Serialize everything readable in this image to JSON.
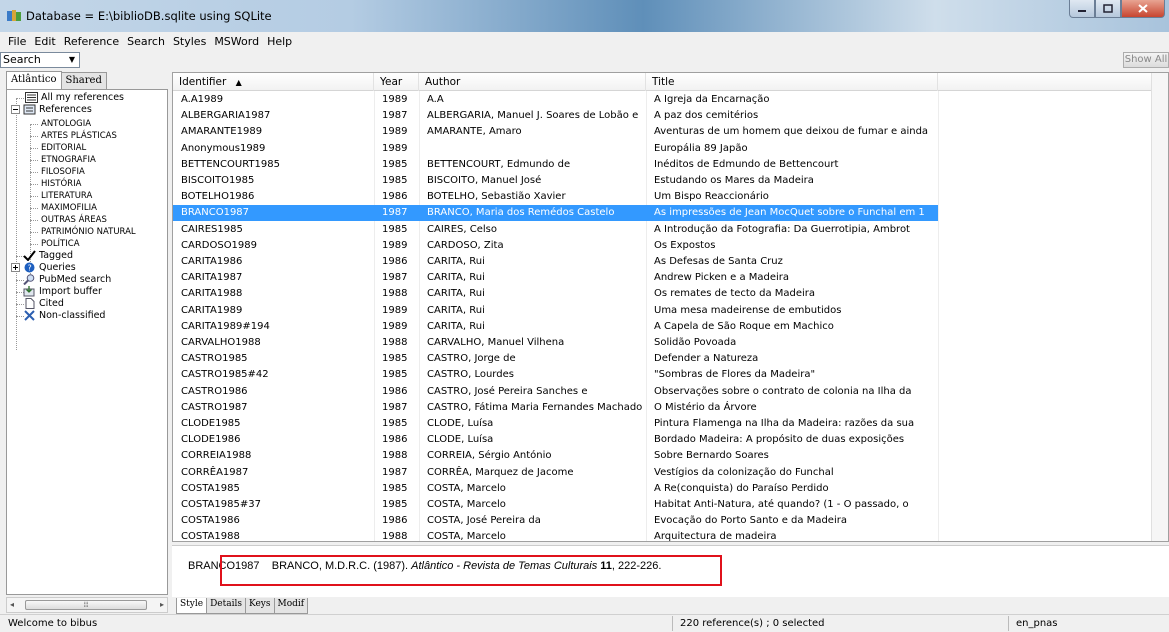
{
  "window": {
    "title": "Database = E:\\biblioDB.sqlite using SQLite",
    "buttons": [
      "min",
      "max",
      "close"
    ]
  },
  "menu": [
    "File",
    "Edit",
    "Reference",
    "Search",
    "Styles",
    "MSWord",
    "Help"
  ],
  "search": {
    "value": "Search",
    "show_all": "Show All"
  },
  "left_tabs": [
    "Atlântico",
    "Shared"
  ],
  "tree": {
    "all_refs": "All my references",
    "references": "References",
    "categories": [
      "ANTOLOGIA",
      "ARTES PLÁSTICAS",
      "EDITORIAL",
      "ETNOGRAFIA",
      "FILOSOFIA",
      "HISTÓRIA",
      "LITERATURA",
      "MAXIMOFILIA",
      "OUTRAS ÁREAS",
      "PATRIMÓNIO NATURAL",
      "POLÍTICA"
    ],
    "tagged": "Tagged",
    "queries": "Queries",
    "pubmed": "PubMed search",
    "import": "Import buffer",
    "cited": "Cited",
    "nonclassified": "Non-classified"
  },
  "table": {
    "headers": [
      "Identifier",
      "Year",
      "Author",
      "Title"
    ],
    "rows": [
      [
        "A.A1989",
        "1989",
        "A.A",
        "A Igreja da Encarnação"
      ],
      [
        "ALBERGARIA1987",
        "1987",
        "ALBERGARIA, Manuel J. Soares de Lobão e",
        "A paz dos cemitérios"
      ],
      [
        "AMARANTE1989",
        "1989",
        "AMARANTE, Amaro",
        "Aventuras de um homem que deixou de fumar e ainda"
      ],
      [
        "Anonymous1989",
        "1989",
        "",
        "Europália 89 Japão"
      ],
      [
        "BETTENCOURT1985",
        "1985",
        "BETTENCOURT, Edmundo de",
        "Inéditos de Edmundo de Bettencourt"
      ],
      [
        "BISCOITO1985",
        "1985",
        "BISCOITO, Manuel José",
        "Estudando os Mares da Madeira"
      ],
      [
        "BOTELHO1986",
        "1986",
        "BOTELHO, Sebastião Xavier",
        "Um Bispo Reaccionário"
      ],
      [
        "BRANCO1987",
        "1987",
        "BRANCO, Maria dos Remédos Castelo",
        "As impressões de Jean MocQuet sobre o Funchal em 1"
      ],
      [
        "CAIRES1985",
        "1985",
        "CAIRES, Celso",
        "A Introdução da Fotografia: Da Guerrotipia, Ambrot"
      ],
      [
        "CARDOSO1989",
        "1989",
        "CARDOSO, Zita",
        "Os Expostos"
      ],
      [
        "CARITA1986",
        "1986",
        "CARITA, Rui",
        "As Defesas de Santa Cruz"
      ],
      [
        "CARITA1987",
        "1987",
        "CARITA, Rui",
        "Andrew Picken e a Madeira"
      ],
      [
        "CARITA1988",
        "1988",
        "CARITA, Rui",
        "Os remates de tecto da Madeira"
      ],
      [
        "CARITA1989",
        "1989",
        "CARITA, Rui",
        "Uma mesa madeirense de embutidos"
      ],
      [
        "CARITA1989#194",
        "1989",
        "CARITA, Rui",
        "A Capela de São Roque em Machico"
      ],
      [
        "CARVALHO1988",
        "1988",
        "CARVALHO, Manuel Vilhena",
        "Solidão Povoada"
      ],
      [
        "CASTRO1985",
        "1985",
        "CASTRO, Jorge de",
        "Defender a Natureza"
      ],
      [
        "CASTRO1985#42",
        "1985",
        "CASTRO, Lourdes",
        "\"Sombras de Flores da Madeira\""
      ],
      [
        "CASTRO1986",
        "1986",
        "CASTRO, José Pereira Sanches e",
        "Observações sobre o contrato de colonia na Ilha da"
      ],
      [
        "CASTRO1987",
        "1987",
        "CASTRO, Fátima Maria Fernandes Machado",
        "O Mistério da Árvore"
      ],
      [
        "CLODE1985",
        "1985",
        "CLODE, Luísa",
        "Pintura Flamenga na Ilha da Madeira: razões da sua"
      ],
      [
        "CLODE1986",
        "1986",
        "CLODE, Luísa",
        "Bordado Madeira: A propósito de duas exposições"
      ],
      [
        "CORREIA1988",
        "1988",
        "CORREIA, Sérgio António",
        "Sobre Bernardo Soares"
      ],
      [
        "CORRÊA1987",
        "1987",
        "CORRÊA, Marquez de Jacome",
        "Vestígios da colonização do Funchal"
      ],
      [
        "COSTA1985",
        "1985",
        "COSTA, Marcelo",
        "A Re(conquista) do Paraíso Perdido"
      ],
      [
        "COSTA1985#37",
        "1985",
        "COSTA, Marcelo",
        "Habitat Anti-Natura, até quando? (1 - O passado, o"
      ],
      [
        "COSTA1986",
        "1986",
        "COSTA, José Pereira da",
        "Evocação do Porto Santo e da Madeira"
      ],
      [
        "COSTA1988",
        "1988",
        "COSTA, Marcelo",
        "Arquitectura de madeira"
      ]
    ],
    "selected_index": 7
  },
  "preview": {
    "id": "BRANCO1987",
    "authors": "BRANCO, M.D.R.C. (1987).",
    "journal": "Atlântico - Revista de Temas Culturais",
    "volume": "11",
    "pages": ", 222-226."
  },
  "bottom_tabs": [
    "Style",
    "Details",
    "Keys",
    "Modif"
  ],
  "status": {
    "left": "Welcome to bibus",
    "mid": "220 reference(s) ; 0 selected",
    "right": "en_pnas"
  },
  "colors": {
    "selection": "#3399ff",
    "highlight_box": "#e0111b"
  }
}
